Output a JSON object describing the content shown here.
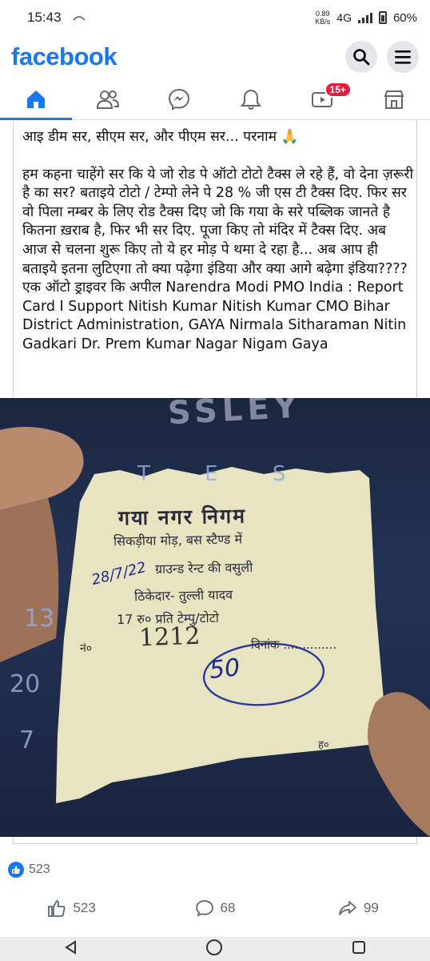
{
  "status_bar": {
    "time": "15:43",
    "net_speed_value": "0.89",
    "net_speed_unit": "KB/s",
    "network": "4G",
    "battery": "60%"
  },
  "header": {
    "logo": "facebook",
    "search_icon": "search-icon",
    "menu_icon": "menu-icon"
  },
  "tabs": [
    {
      "name": "home",
      "icon": "home-icon",
      "active": true
    },
    {
      "name": "friends",
      "icon": "friends-icon"
    },
    {
      "name": "messenger",
      "icon": "messenger-icon"
    },
    {
      "name": "notifications",
      "icon": "bell-icon"
    },
    {
      "name": "video",
      "icon": "video-icon",
      "badge": "15+"
    },
    {
      "name": "marketplace",
      "icon": "marketplace-icon"
    }
  ],
  "post": {
    "greeting": "आइ डीम सर, सीएम सर, और पीएम सर... परनाम 🙏",
    "body": "हम कहना चाहेंगे सर कि ये जो रोड पे ऑटो टोटो टैक्स ले रहे हैं, वो देना ज़रूरी है का सर? बताइये टोटो / टेम्पो लेने पे 28 % जी एस टी टैक्स दिए. फिर सर वो पिला नम्बर के लिए रोड टैक्स दिए जो कि गया के सरे पब्लिक जानते है कितना ख़राब है, फिर भी सर दिए. पूजा किए तो मंदिर में टैक्स दिए. अब आज से चलना शुरू किए तो ये हर मोड़ पे थमा दे रहा है... अब आप ही बताइये इतना लुटिएगा तो क्या पढ़ेगा इंडिया और क्या आगे बढ़ेगा इंडिया????",
    "appeal": "एक ऑटो ड्राइवर कि अपील Narendra Modi PMO India : Report Card I Support Nitish Kumar Nitish Kumar CMO Bihar District Administration, GAYA Nirmala Sitharaman Nitin Gadkari Dr. Prem Kumar  Nagar Nigam Gaya"
  },
  "receipt": {
    "title": "गया नगर निगम",
    "line2": "सिकड़ीया मोड़, बस स्टैण्ड में",
    "line3": "ग्राउन्ड रेन्ट की वसुली",
    "line4": "ठिकेदार- तुल्ली यादव",
    "line5": "17 रु० प्रति टेम्पु/टोटो",
    "number_label": "नं०",
    "number": "1212",
    "date_label": "दिनांक ..............",
    "handwritten_date": "28/7/22",
    "handwritten_amount": "50",
    "sign_label": "ह०"
  },
  "photo_background_text": {
    "top": "SSLEY",
    "letters": "T  E  S",
    "n13": "13",
    "n20": "20",
    "n7": "7"
  },
  "reactions": {
    "count": "523"
  },
  "actions": {
    "like_count": "523",
    "comment_count": "68",
    "share_count": "99"
  },
  "colors": {
    "brand": "#1877f2",
    "badge": "#e41e3f"
  }
}
